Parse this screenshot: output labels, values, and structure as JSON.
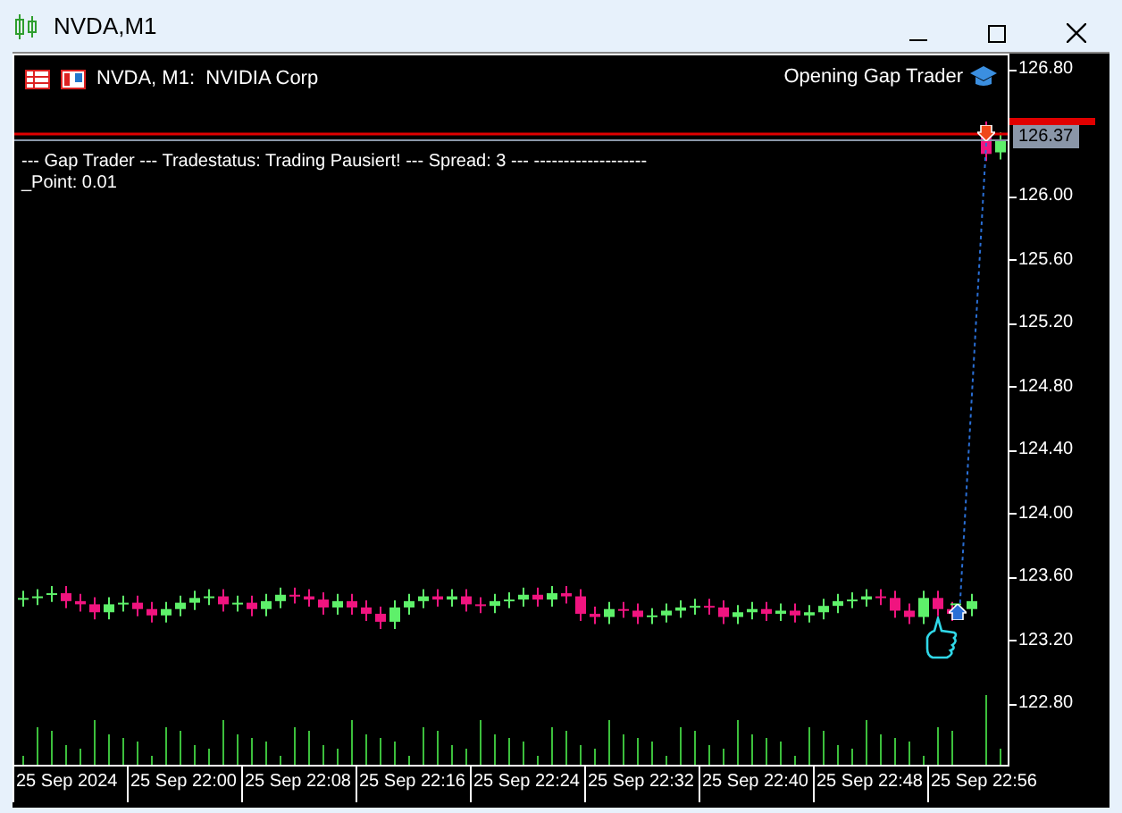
{
  "window": {
    "title": "NVDA,M1"
  },
  "chart": {
    "symbol": "NVDA, M1:  NVIDIA Corp",
    "expert": "Opening Gap Trader",
    "comment": [
      "--- Gap Trader --- Tradestatus: Trading Pausiert! --- Spread: 3 --- -------------------",
      "_Point: 0.01"
    ],
    "price_labels": [
      "126.80",
      "126.00",
      "125.60",
      "125.20",
      "124.80",
      "124.40",
      "124.00",
      "123.60",
      "123.20",
      "122.80"
    ],
    "current_price": "126.37",
    "time_labels": [
      "25 Sep 2024",
      "25 Sep 22:00",
      "25 Sep 22:08",
      "25 Sep 22:16",
      "25 Sep 22:24",
      "25 Sep 22:32",
      "25 Sep 22:40",
      "25 Sep 22:48",
      "25 Sep 22:56"
    ]
  }
}
